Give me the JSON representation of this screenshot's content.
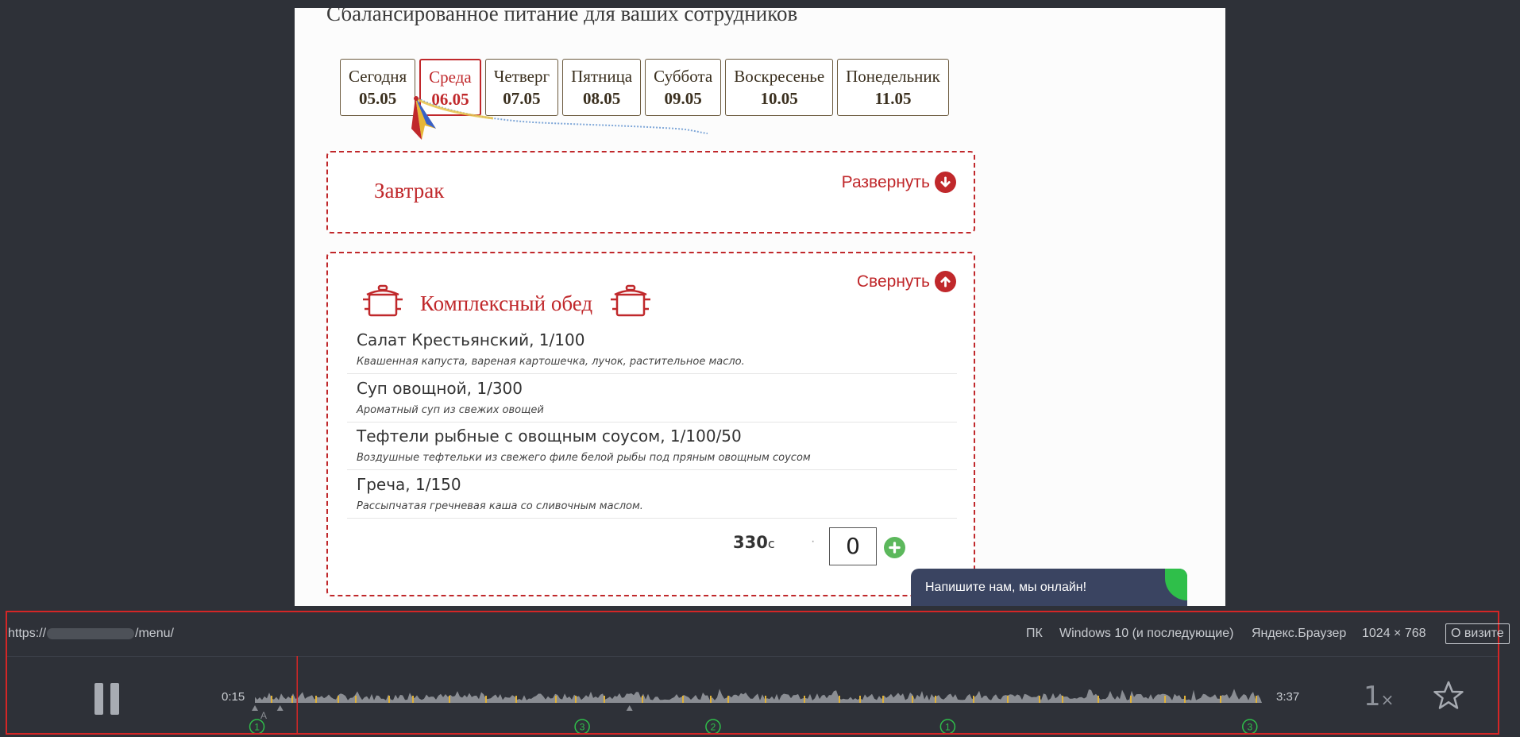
{
  "page": {
    "title": "Сбалансированное питание для ваших сотрудников",
    "days": [
      {
        "name": "Сегодня",
        "date": "05.05",
        "active": false
      },
      {
        "name": "Среда",
        "date": "06.05",
        "active": true
      },
      {
        "name": "Четверг",
        "date": "07.05",
        "active": false
      },
      {
        "name": "Пятница",
        "date": "08.05",
        "active": false
      },
      {
        "name": "Суббота",
        "date": "09.05",
        "active": false
      },
      {
        "name": "Воскресенье",
        "date": "10.05",
        "active": false
      },
      {
        "name": "Понедельник",
        "date": "11.05",
        "active": false
      }
    ],
    "breakfast": {
      "title": "Завтрак",
      "toggle": "Развернуть",
      "icon": "arrow-down-circle-icon"
    },
    "lunch": {
      "title": "Комплексный обед",
      "toggle": "Свернуть",
      "icon": "arrow-up-circle-icon",
      "items": [
        {
          "name": "Салат Крестьянский, 1/100",
          "desc": "Квашенная капуста, вареная картошечка, лучок, растительное масло."
        },
        {
          "name": "Суп овощной, 1/300",
          "desc": "Ароматный суп из свежих овощей"
        },
        {
          "name": "Тефтели рыбные с овощным соусом, 1/100/50",
          "desc": "Воздушные тефтельки из свежего филе белой рыбы под пряным овощным соусом"
        },
        {
          "name": "Греча, 1/150",
          "desc": "Рассыпчатая гречневая каша со сливочным маслом."
        }
      ],
      "price": "330",
      "currency": "c",
      "separator": "·",
      "quantity": "0"
    },
    "chat": {
      "label": "Напишите нам, мы онлайн!"
    }
  },
  "player": {
    "url_prefix": "https://",
    "url_suffix": "/menu/",
    "device": "ПК",
    "os": "Windows 10 (и последующие)",
    "browser": "Яндекс.Браузер",
    "resolution": "1024 × 768",
    "visit_button": "О визите",
    "time_current": "0:15",
    "time_total": "3:37",
    "progress": 0.042,
    "speed": "1",
    "speed_unit": "×",
    "markers": [
      {
        "label": "1",
        "position": 0.002
      },
      {
        "label": "3",
        "position": 0.325
      },
      {
        "label": "2",
        "position": 0.455
      },
      {
        "label": "1",
        "position": 0.688
      },
      {
        "label": "3",
        "position": 0.988
      }
    ],
    "event_marks": [
      {
        "label": "A",
        "position": 0.0
      }
    ],
    "colors": {
      "accent": "#d42626",
      "marker": "#2fbf4a",
      "highlight": "#e0b23a",
      "wave": "#8a8d93"
    }
  }
}
